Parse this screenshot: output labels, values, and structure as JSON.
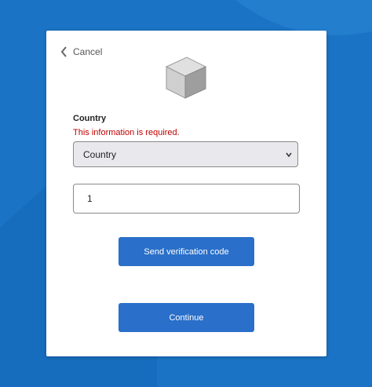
{
  "colors": {
    "background": "#1a73c4",
    "accent": "#2a6fc9",
    "error": "#c00000"
  },
  "header": {
    "cancel_label": "Cancel"
  },
  "logo": {
    "icon": "cube-icon"
  },
  "country": {
    "label": "Country",
    "error": "This information is required.",
    "selected": "Country"
  },
  "phone": {
    "value": "1"
  },
  "buttons": {
    "send_code": "Send verification code",
    "continue": "Continue"
  }
}
